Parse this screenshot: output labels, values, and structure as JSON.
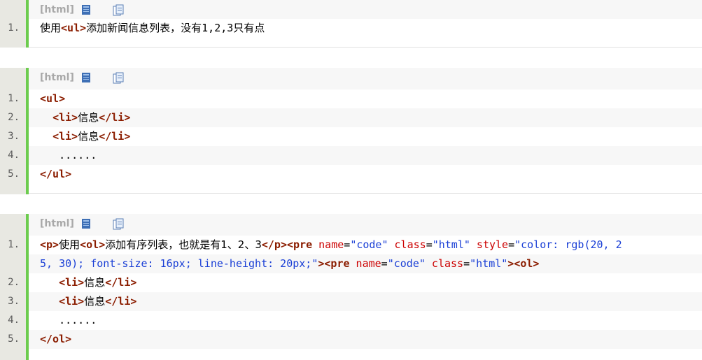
{
  "block1": {
    "lang": "[html]",
    "lines": [
      {
        "num": "1.",
        "parts": [
          {
            "t": "使用",
            "c": "cn"
          },
          {
            "t": "<ul>",
            "c": "tag"
          },
          {
            "t": "添加新闻信息列表，没有",
            "c": "cn"
          },
          {
            "t": "1,2,3",
            "c": "plain"
          },
          {
            "t": "只有点",
            "c": "cn"
          }
        ]
      }
    ]
  },
  "block2": {
    "lang": "[html]",
    "lines": [
      {
        "num": "1.",
        "parts": [
          {
            "t": "<ul>",
            "c": "tag"
          }
        ]
      },
      {
        "num": "2.",
        "parts": [
          {
            "t": "  ",
            "c": "plain"
          },
          {
            "t": "<li>",
            "c": "tag"
          },
          {
            "t": "信息",
            "c": "cn"
          },
          {
            "t": "</li>",
            "c": "tag"
          }
        ]
      },
      {
        "num": "3.",
        "parts": [
          {
            "t": "  ",
            "c": "plain"
          },
          {
            "t": "<li>",
            "c": "tag"
          },
          {
            "t": "信息",
            "c": "cn"
          },
          {
            "t": "</li>",
            "c": "tag"
          }
        ]
      },
      {
        "num": "4.",
        "parts": [
          {
            "t": "   ......",
            "c": "plain"
          }
        ]
      },
      {
        "num": "5.",
        "parts": [
          {
            "t": "</ul>",
            "c": "tag"
          }
        ]
      }
    ]
  },
  "block3": {
    "lang": "[html]",
    "lines": [
      {
        "num": "1.",
        "parts": [
          {
            "t": "<p>",
            "c": "tag"
          },
          {
            "t": "使用",
            "c": "cn"
          },
          {
            "t": "<ol>",
            "c": "tag"
          },
          {
            "t": "添加有序列表，也就是有1、2、3",
            "c": "cn"
          },
          {
            "t": "</p>",
            "c": "tag"
          },
          {
            "t": "<pre",
            "c": "tag"
          },
          {
            "t": " name",
            "c": "attr"
          },
          {
            "t": "=",
            "c": "plain"
          },
          {
            "t": "\"code\"",
            "c": "str"
          },
          {
            "t": " class",
            "c": "attr"
          },
          {
            "t": "=",
            "c": "plain"
          },
          {
            "t": "\"html\"",
            "c": "str"
          },
          {
            "t": " style",
            "c": "attr"
          },
          {
            "t": "=",
            "c": "plain"
          },
          {
            "t": "\"color: rgb(20, 2",
            "c": "str"
          }
        ]
      },
      {
        "num": "",
        "parts": [
          {
            "t": "5, 30); font-size: 16px; line-height: 20px;\"",
            "c": "str"
          },
          {
            "t": "><pre",
            "c": "tag"
          },
          {
            "t": " name",
            "c": "attr"
          },
          {
            "t": "=",
            "c": "plain"
          },
          {
            "t": "\"code\"",
            "c": "str"
          },
          {
            "t": " class",
            "c": "attr"
          },
          {
            "t": "=",
            "c": "plain"
          },
          {
            "t": "\"html\"",
            "c": "str"
          },
          {
            "t": "><ol>",
            "c": "tag"
          }
        ]
      },
      {
        "num": "2.",
        "parts": [
          {
            "t": "   ",
            "c": "plain"
          },
          {
            "t": "<li>",
            "c": "tag"
          },
          {
            "t": "信息",
            "c": "cn"
          },
          {
            "t": "</li>",
            "c": "tag"
          }
        ]
      },
      {
        "num": "3.",
        "parts": [
          {
            "t": "   ",
            "c": "plain"
          },
          {
            "t": "<li>",
            "c": "tag"
          },
          {
            "t": "信息",
            "c": "cn"
          },
          {
            "t": "</li>",
            "c": "tag"
          }
        ]
      },
      {
        "num": "4.",
        "parts": [
          {
            "t": "   ......",
            "c": "plain"
          }
        ]
      },
      {
        "num": "5.",
        "parts": [
          {
            "t": "</ol>",
            "c": "tag"
          }
        ]
      }
    ]
  },
  "icons": [
    "view-source-icon",
    "copy-icon"
  ],
  "colors": {
    "accent_bar": "#6ccc4e",
    "tag": "#8b1d00",
    "attr": "#cc0000",
    "string": "#1a3fd6"
  }
}
